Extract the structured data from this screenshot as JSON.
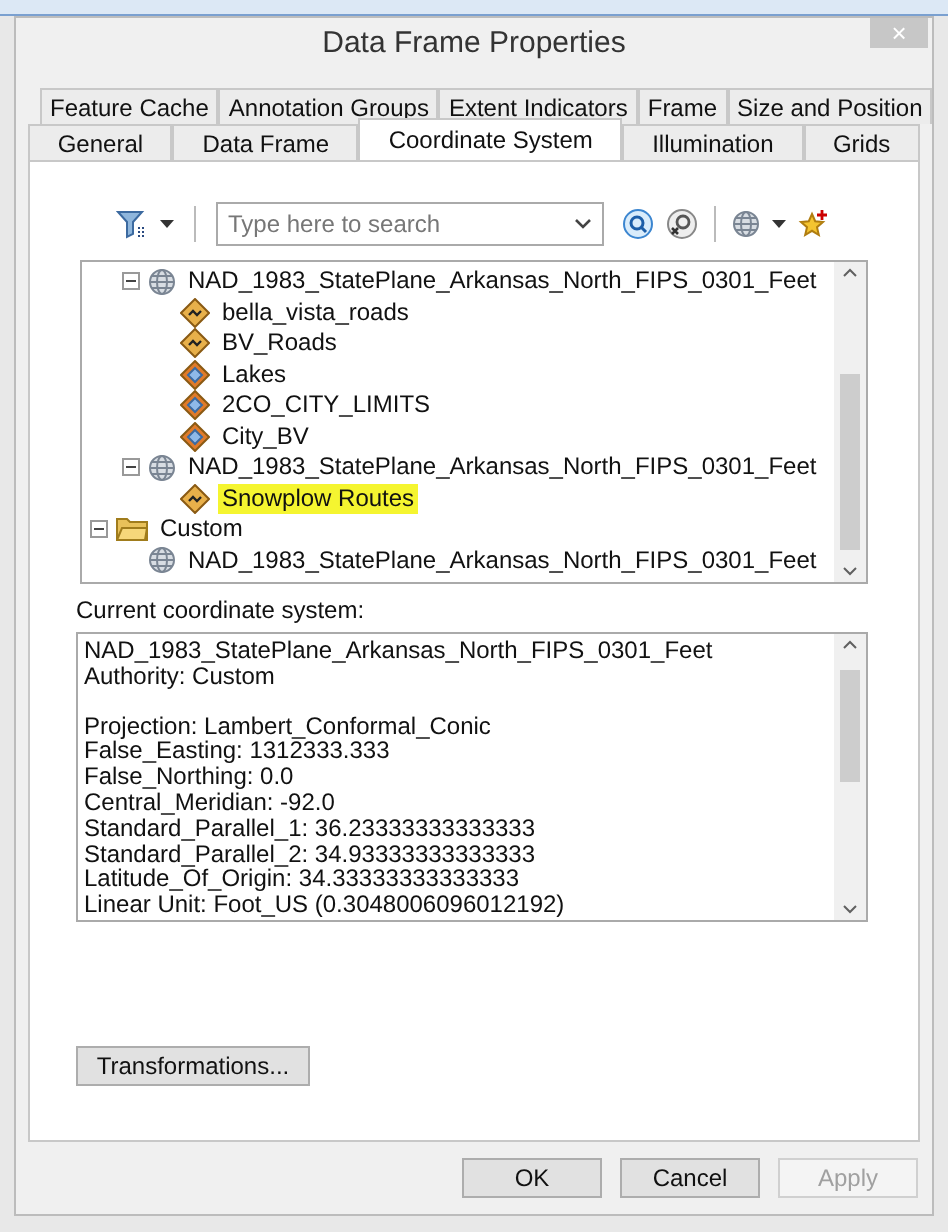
{
  "window": {
    "title": "Data Frame Properties",
    "close": "×"
  },
  "tab_rows": [
    [
      {
        "label": "Feature Cache",
        "selected": false
      },
      {
        "label": "Annotation Groups",
        "selected": false
      },
      {
        "label": "Extent Indicators",
        "selected": false
      },
      {
        "label": "Frame",
        "selected": false
      },
      {
        "label": "Size and Position",
        "selected": false
      }
    ],
    [
      {
        "label": "General",
        "selected": false
      },
      {
        "label": "Data Frame",
        "selected": false
      },
      {
        "label": "Coordinate System",
        "selected": true
      },
      {
        "label": "Illumination",
        "selected": false
      },
      {
        "label": "Grids",
        "selected": false
      }
    ]
  ],
  "search": {
    "placeholder": "Type here to search"
  },
  "tree": [
    {
      "kind": "projection",
      "label": "NAD_1983_StatePlane_Arkansas_North_FIPS_0301_Feet",
      "expanded": true,
      "selected": false,
      "children": [
        {
          "kind": "line-layer",
          "label": "bella_vista_roads",
          "selected": false
        },
        {
          "kind": "line-layer",
          "label": "BV_Roads",
          "selected": false
        },
        {
          "kind": "polygon-layer",
          "label": "Lakes",
          "selected": false
        },
        {
          "kind": "polygon-layer",
          "label": "2CO_CITY_LIMITS",
          "selected": false
        },
        {
          "kind": "polygon-layer",
          "label": "City_BV",
          "selected": false
        }
      ]
    },
    {
      "kind": "projection",
      "label": "NAD_1983_StatePlane_Arkansas_North_FIPS_0301_Feet",
      "expanded": true,
      "selected": false,
      "children": [
        {
          "kind": "line-layer",
          "label": "Snowplow Routes",
          "selected": true
        }
      ]
    },
    {
      "kind": "folder",
      "label": "Custom",
      "expanded": true,
      "selected": false,
      "children": [
        {
          "kind": "projection",
          "label": "NAD_1983_StatePlane_Arkansas_North_FIPS_0301_Feet",
          "selected": false
        }
      ]
    }
  ],
  "current_label": "Current coordinate system:",
  "current_system": [
    [
      "NAD_1983_StatePlane_Arkansas_North_FIPS_0301_Feet",
      "Authority: Custom"
    ],
    [
      "Projection: Lambert_Conformal_Conic",
      "False_Easting: 1312333.333",
      "False_Northing: 0.0",
      "Central_Meridian: -92.0",
      "Standard_Parallel_1: 36.23333333333333",
      "Standard_Parallel_2: 34.93333333333333",
      "Latitude_Of_Origin: 34.33333333333333",
      "Linear Unit: Foot_US (0.3048006096012192)"
    ]
  ],
  "transform_button": "Transformations...",
  "buttons": [
    {
      "label": "OK",
      "disabled": false
    },
    {
      "label": "Cancel",
      "disabled": false
    },
    {
      "label": "Apply",
      "disabled": true
    }
  ]
}
